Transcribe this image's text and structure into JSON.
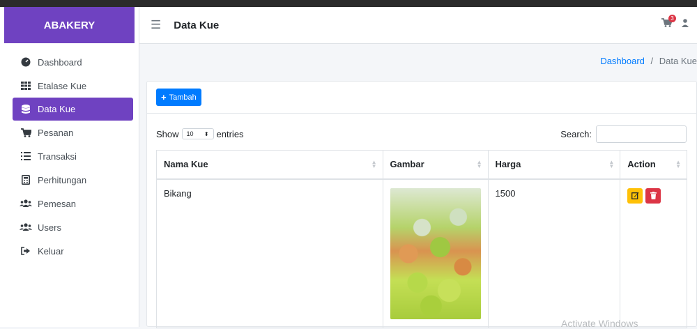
{
  "brand": "ABAKERY",
  "sidebar": {
    "items": [
      {
        "label": "Dashboard",
        "icon": "tachometer-icon",
        "active": false
      },
      {
        "label": "Etalase Kue",
        "icon": "grid-icon",
        "active": false
      },
      {
        "label": "Data Kue",
        "icon": "database-icon",
        "active": true
      },
      {
        "label": "Pesanan",
        "icon": "cart-icon",
        "active": false
      },
      {
        "label": "Transaksi",
        "icon": "list-icon",
        "active": false
      },
      {
        "label": "Perhitungan",
        "icon": "calculator-icon",
        "active": false
      },
      {
        "label": "Pemesan",
        "icon": "users-icon",
        "active": false
      },
      {
        "label": "Users",
        "icon": "users-icon",
        "active": false
      },
      {
        "label": "Keluar",
        "icon": "sign-out-icon",
        "active": false
      }
    ]
  },
  "navbar": {
    "title": "Data Kue",
    "cart_count": "3"
  },
  "breadcrumb": {
    "link": "Dashboard",
    "separator": "/",
    "current": "Data Kue"
  },
  "card": {
    "add_label": "Tambah"
  },
  "controls": {
    "show_label": "Show",
    "length_value": "10",
    "entries_label": "entries",
    "search_label": "Search:"
  },
  "table": {
    "headers": [
      "Nama Kue",
      "Gambar",
      "Harga",
      "Action"
    ],
    "rows": [
      {
        "nama": "Bikang",
        "harga": "1500"
      }
    ]
  },
  "watermark": "Activate Windows",
  "colors": {
    "accent": "#6f42c1",
    "primary": "#007bff",
    "warning": "#ffc107",
    "danger": "#dc3545"
  }
}
